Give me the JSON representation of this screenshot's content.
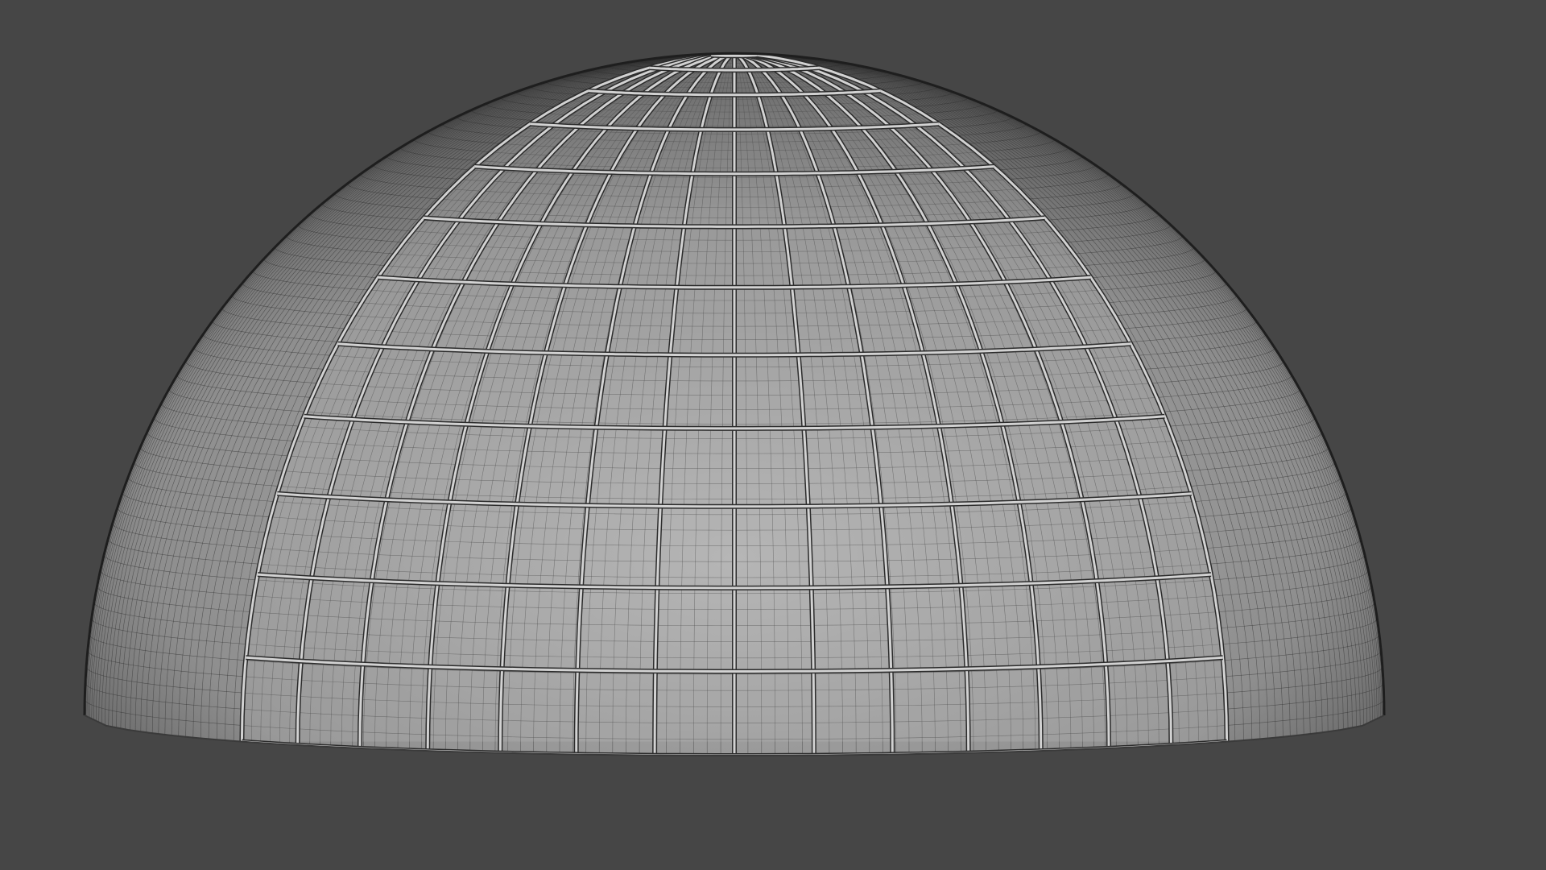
{
  "viewport": {
    "background_color": "#464646"
  },
  "dome": {
    "surface_light": "#b2b2b2",
    "surface_mid": "#8e8e8e",
    "surface_dark": "#5c5c5c",
    "wire_color": "#2a2a2a",
    "panel_frame_color": "#d2d2d2",
    "panel_frame_outline": "#2c2c2c",
    "fine_wire_count_vertical": 150,
    "fine_wire_count_horizontal": 64,
    "panel_columns": 14,
    "panel_rows": 12
  }
}
